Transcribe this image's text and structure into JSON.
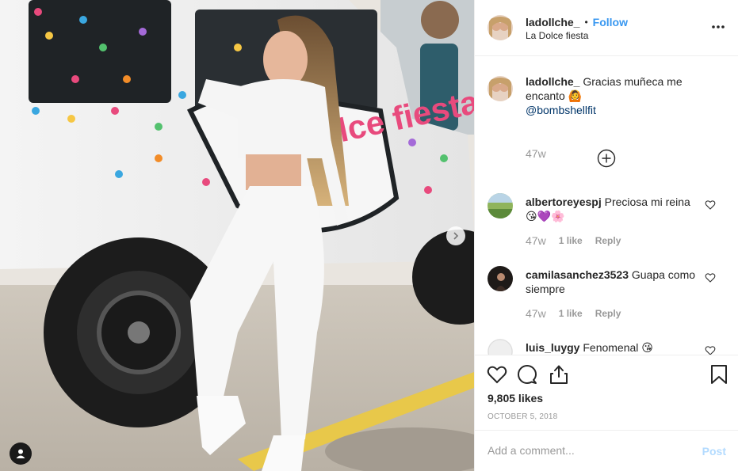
{
  "header": {
    "username": "ladollche_",
    "separator": "•",
    "follow_label": "Follow",
    "location": "La Dolce fiesta",
    "more_icon": "more-options-icon"
  },
  "caption": {
    "username": "ladollche_",
    "text": "Gracias muñeca me encanto 🙆",
    "mention": "@bombshellfit",
    "time": "47w"
  },
  "load_more_icon": "plus-circle-icon",
  "comments": [
    {
      "username": "albertoreyespj",
      "text": "Preciosa mi reina",
      "emojis": "😘💜🌸",
      "time": "47w",
      "likes": "1 like",
      "reply": "Reply"
    },
    {
      "username": "camilasanchez3523",
      "text": "Guapa como siempre",
      "emojis": "",
      "time": "47w",
      "likes": "1 like",
      "reply": "Reply"
    },
    {
      "username": "luis_luygy",
      "text": "Fenomenal",
      "emojis": "😘",
      "time": "",
      "likes": "",
      "reply": ""
    }
  ],
  "actions": {
    "like_icon": "heart-icon",
    "comment_icon": "comment-icon",
    "share_icon": "share-icon",
    "save_icon": "bookmark-icon",
    "likes": "9,805 likes",
    "date": "OCTOBER 5, 2018"
  },
  "add_comment": {
    "placeholder": "Add a comment...",
    "post_label": "Post"
  },
  "photo": {
    "next_icon": "chevron-right-icon",
    "tag_icon": "user-tag-icon",
    "truck_text": "dolce fiesta"
  }
}
